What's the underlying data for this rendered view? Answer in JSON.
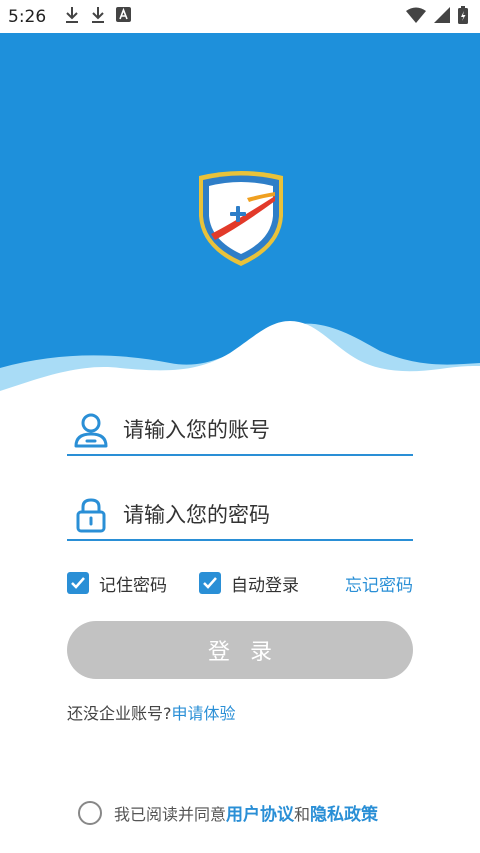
{
  "status_bar": {
    "time": "5:26",
    "icons": [
      "download-icon",
      "download-icon",
      "app-a-icon",
      "wifi-icon",
      "signal-icon",
      "battery-charging-icon"
    ]
  },
  "logo": {
    "icon": "shield-plus-icon"
  },
  "form": {
    "account_placeholder": "请输入您的账号",
    "password_placeholder": "请输入您的密码",
    "account_icon": "user-icon",
    "password_icon": "lock-icon"
  },
  "options": {
    "remember_label": "记住密码",
    "remember_checked": true,
    "auto_login_label": "自动登录",
    "auto_login_checked": true,
    "forgot_label": "忘记密码"
  },
  "login_button": {
    "label": "登录"
  },
  "apply": {
    "prompt": "还没企业账号?",
    "link": "申请体验"
  },
  "agreement": {
    "prefix": "我已阅读并同意",
    "user_agreement": "用户协议",
    "and": "和",
    "privacy_policy": "隐私政策",
    "checked": false
  },
  "colors": {
    "primary": "#2a8fd6",
    "hero": "#1e90db",
    "button_disabled": "#c2c2c2"
  }
}
